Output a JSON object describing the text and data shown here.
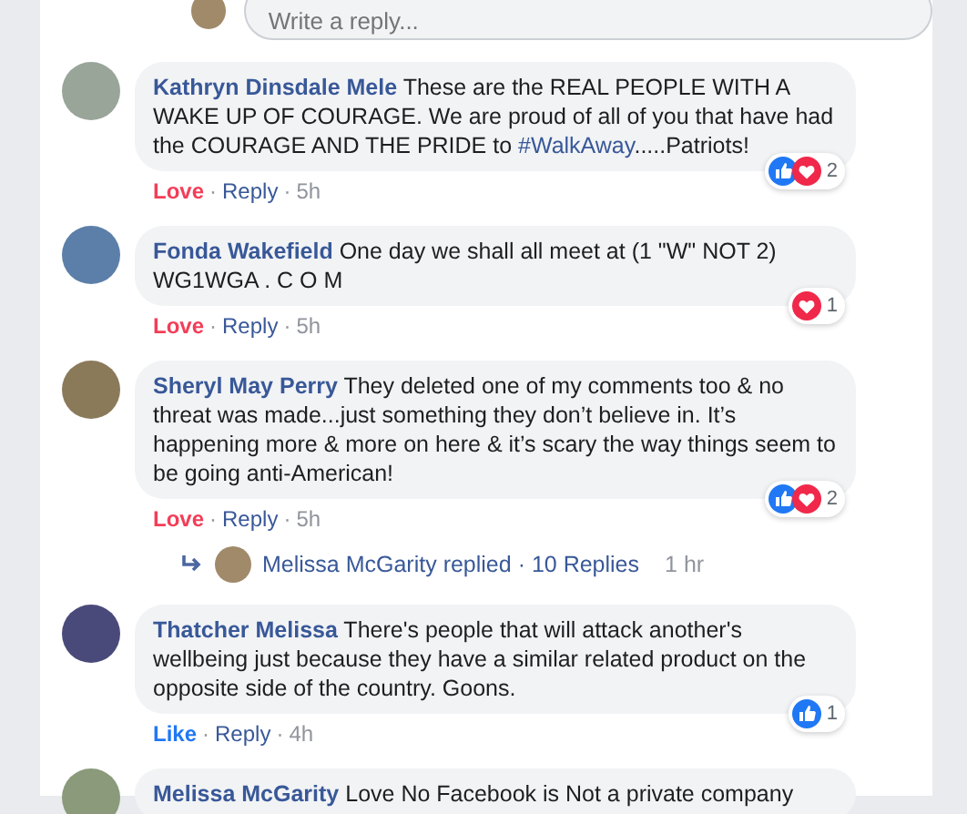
{
  "reply_box": {
    "placeholder": "Write a reply..."
  },
  "comments": [
    {
      "author": "Kathryn Dinsdale Mele",
      "text": "These are the REAL PEOPLE WITH A WAKE UP OF COURAGE. We are proud of all of you that have had the COURAGE AND THE PRIDE to ",
      "hashtag": "#WalkAway",
      "text_after": ".....Patriots!",
      "reaction_link": {
        "label": "Love",
        "kind": "love"
      },
      "separators": [
        "·",
        "·"
      ],
      "reply": "Reply",
      "time": "5h",
      "reactions": [
        {
          "kind": "like"
        },
        {
          "kind": "love"
        }
      ],
      "reaction_count": "2"
    },
    {
      "author": "Fonda Wakefield",
      "text": "One day we shall all meet at (1 \"W\" NOT 2) WG1WGA . C O M",
      "reaction_link": {
        "label": "Love",
        "kind": "love"
      },
      "separators": [
        "·",
        "·"
      ],
      "reply": "Reply",
      "time": "5h",
      "reactions": [
        {
          "kind": "love"
        }
      ],
      "reaction_count": "1"
    },
    {
      "author": "Sheryl May Perry",
      "text": "They deleted one of my comments too & no threat was made...just something they don’t believe in. It’s happening more & more on here & it’s scary the way things seem to be going anti-American!",
      "reaction_link": {
        "label": "Love",
        "kind": "love"
      },
      "separators": [
        "·",
        "·"
      ],
      "reply": "Reply",
      "time": "5h",
      "reactions": [
        {
          "kind": "like"
        },
        {
          "kind": "love"
        }
      ],
      "reaction_count": "2",
      "replies": {
        "summary": "Melissa McGarity replied · 10 Replies",
        "time": "1 hr"
      }
    },
    {
      "author": "Thatcher Melissa",
      "text": "There's people that will attack another's wellbeing just because they have a similar related product on the opposite side of the country. Goons.",
      "reaction_link": {
        "label": "Like",
        "kind": "like"
      },
      "separators": [
        "·",
        "·"
      ],
      "reply": "Reply",
      "time": "4h",
      "reactions": [
        {
          "kind": "like"
        }
      ],
      "reaction_count": "1"
    },
    {
      "author": "Melissa McGarity",
      "text": "Love No Facebook is Not a private company"
    }
  ]
}
